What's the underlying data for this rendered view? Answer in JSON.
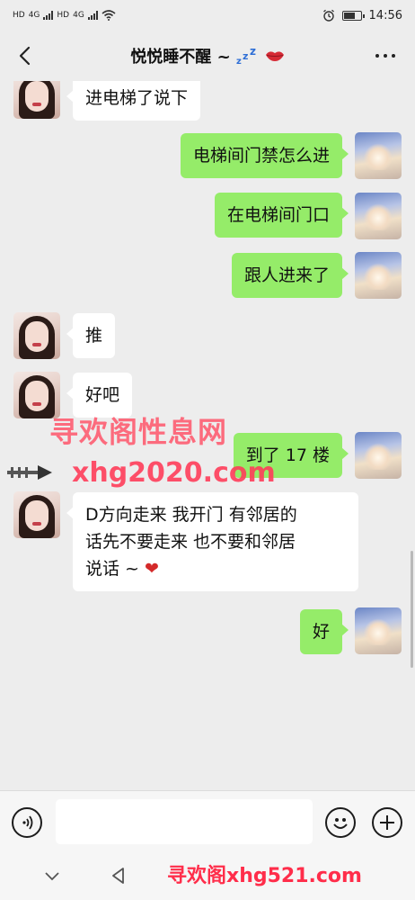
{
  "status_bar": {
    "left_indicators": [
      "HD",
      "4G",
      "HD",
      "4G"
    ],
    "time": "14:56"
  },
  "header": {
    "title": "悦悦睡不醒 ~",
    "title_emoji": "zzz",
    "title_icon": "lips-icon"
  },
  "messages": [
    {
      "side": "left",
      "text": "进电梯了说下"
    },
    {
      "side": "right",
      "text": "电梯间门禁怎么进"
    },
    {
      "side": "right",
      "text": "在电梯间门口"
    },
    {
      "side": "right",
      "text": "跟人进来了"
    },
    {
      "side": "left",
      "text": "推"
    },
    {
      "side": "left",
      "text": "好吧"
    },
    {
      "side": "right",
      "text": "到了 17 楼"
    },
    {
      "side": "left",
      "lines": [
        "D方向走来 我开门 有邻居的",
        "话先不要走来 也不要和邻居",
        "说话 ~ "
      ],
      "trailing_emoji": "❤"
    },
    {
      "side": "right",
      "text": "好"
    }
  ],
  "watermarks": {
    "line1": "寻欢阁性息网",
    "line2": "xhg2020.com",
    "bottom": "寻欢阁xhg521.com"
  },
  "colors": {
    "background": "#ededed",
    "bubble_sent": "#95ec69",
    "bubble_received": "#ffffff",
    "watermark": "#ff3d5a"
  }
}
